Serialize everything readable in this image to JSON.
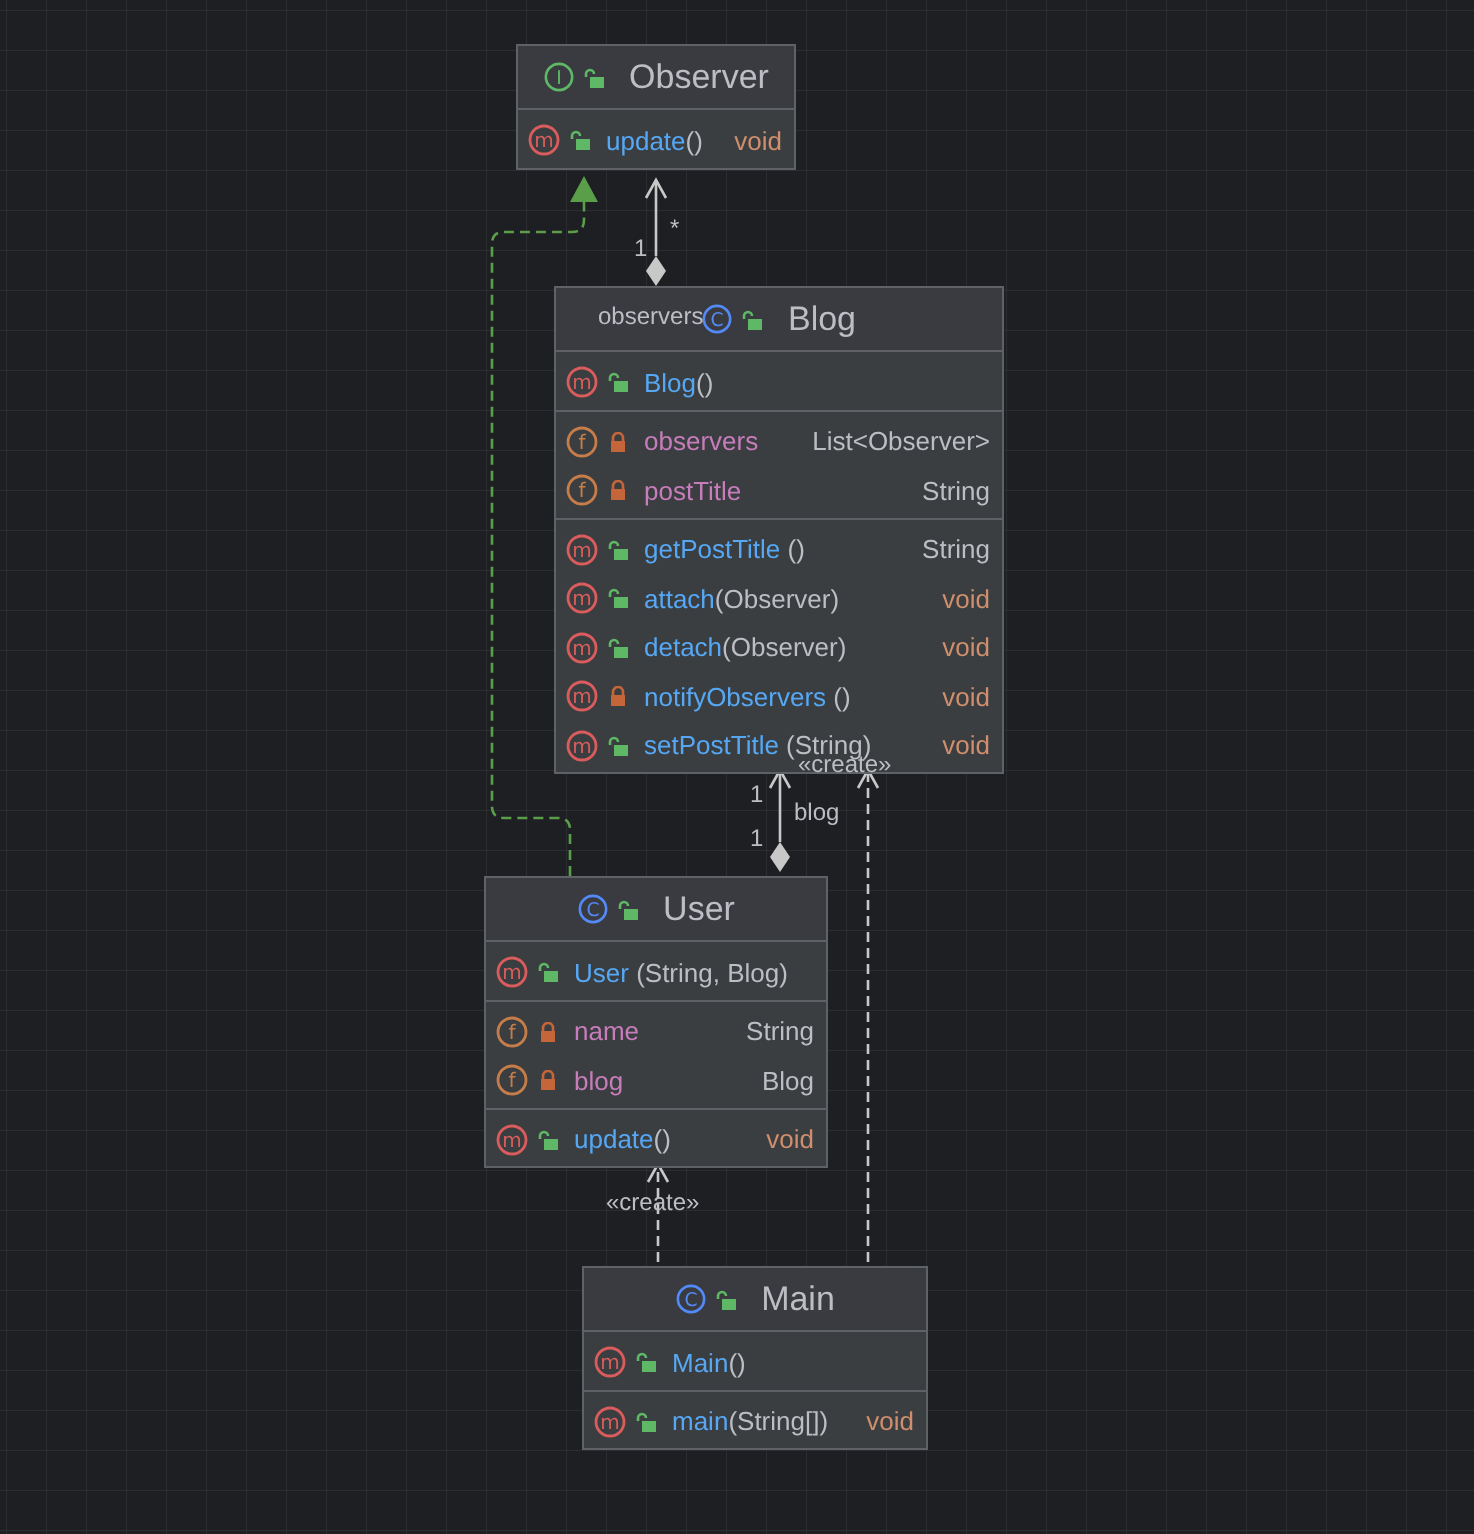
{
  "classes": [
    {
      "kind": "interface",
      "icon_letter": "I",
      "private": false,
      "name": "Observer",
      "sections": [
        [
          {
            "kind": "method",
            "icon_letter": "m",
            "private": false,
            "name": "update",
            "params": "()",
            "type": "void",
            "primitive": true
          }
        ]
      ]
    },
    {
      "kind": "class",
      "icon_letter": "C",
      "private": false,
      "name": "Blog",
      "sections": [
        [
          {
            "kind": "method",
            "icon_letter": "m",
            "private": false,
            "name": "Blog",
            "params": "()"
          }
        ],
        [
          {
            "kind": "field",
            "icon_letter": "f",
            "private": true,
            "name": "observers",
            "type": "List<Observer>",
            "primitive": false
          },
          {
            "kind": "field",
            "icon_letter": "f",
            "private": true,
            "name": "postTitle",
            "type": "String",
            "primitive": false
          }
        ],
        [
          {
            "kind": "method",
            "icon_letter": "m",
            "private": false,
            "name": "getPostTitle",
            "params": " ()",
            "type": "String",
            "primitive": false
          },
          {
            "kind": "method",
            "icon_letter": "m",
            "private": false,
            "name": "attach",
            "params": "(Observer)",
            "type": "void",
            "primitive": true
          },
          {
            "kind": "method",
            "icon_letter": "m",
            "private": false,
            "name": "detach",
            "params": "(Observer)",
            "type": "void",
            "primitive": true
          },
          {
            "kind": "method",
            "icon_letter": "m",
            "private": true,
            "name": "notifyObservers",
            "params": " ()",
            "type": "void",
            "primitive": true
          },
          {
            "kind": "method",
            "icon_letter": "m",
            "private": false,
            "name": "setPostTitle",
            "params": " (String)",
            "type": "void",
            "primitive": true
          }
        ]
      ]
    },
    {
      "kind": "class",
      "icon_letter": "C",
      "private": false,
      "name": "User",
      "sections": [
        [
          {
            "kind": "method",
            "icon_letter": "m",
            "private": false,
            "name": "User",
            "params": " (String, Blog)"
          }
        ],
        [
          {
            "kind": "field",
            "icon_letter": "f",
            "private": true,
            "name": "name",
            "type": "String",
            "primitive": false
          },
          {
            "kind": "field",
            "icon_letter": "f",
            "private": true,
            "name": "blog",
            "type": "Blog",
            "primitive": false
          }
        ],
        [
          {
            "kind": "method",
            "icon_letter": "m",
            "private": false,
            "name": "update",
            "params": "()",
            "type": "void",
            "primitive": true
          }
        ]
      ]
    },
    {
      "kind": "class",
      "icon_letter": "C",
      "private": false,
      "name": "Main",
      "sections": [
        [
          {
            "kind": "method",
            "icon_letter": "m",
            "private": false,
            "name": "Main",
            "params": "()"
          }
        ],
        [
          {
            "kind": "method",
            "icon_letter": "m",
            "private": false,
            "name": "main",
            "params": "(String[])",
            "type": "void",
            "primitive": true
          }
        ]
      ]
    }
  ],
  "edges": [
    {
      "kind": "composition",
      "labels": [
        "*",
        "1",
        "observers"
      ]
    },
    {
      "kind": "realization"
    },
    {
      "kind": "composition",
      "labels": [
        "1",
        "blog",
        "1"
      ]
    },
    {
      "kind": "create",
      "labels": [
        "«create»"
      ]
    },
    {
      "kind": "create",
      "labels": [
        "«create»"
      ]
    }
  ]
}
